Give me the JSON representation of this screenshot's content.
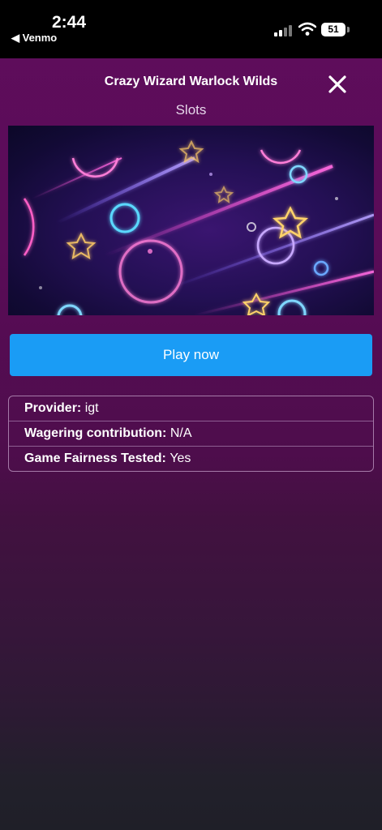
{
  "status_bar": {
    "time": "2:44",
    "back_app": "◀ Venmo",
    "battery": "51"
  },
  "modal": {
    "title": "Crazy Wizard Warlock Wilds",
    "category": "Slots",
    "play_label": "Play now",
    "info": [
      {
        "label": "Provider:",
        "value": "igt"
      },
      {
        "label": "Wagering contribution:",
        "value": "N/A"
      },
      {
        "label": "Game Fairness Tested:",
        "value": "Yes"
      }
    ]
  },
  "icons": {
    "close": "close-icon",
    "signal": "signal-icon",
    "wifi": "wifi-icon",
    "battery": "battery-icon"
  },
  "colors": {
    "background": "#5f0d5c",
    "play_button": "#1a9cf5",
    "info_border": "#a57aa8"
  }
}
